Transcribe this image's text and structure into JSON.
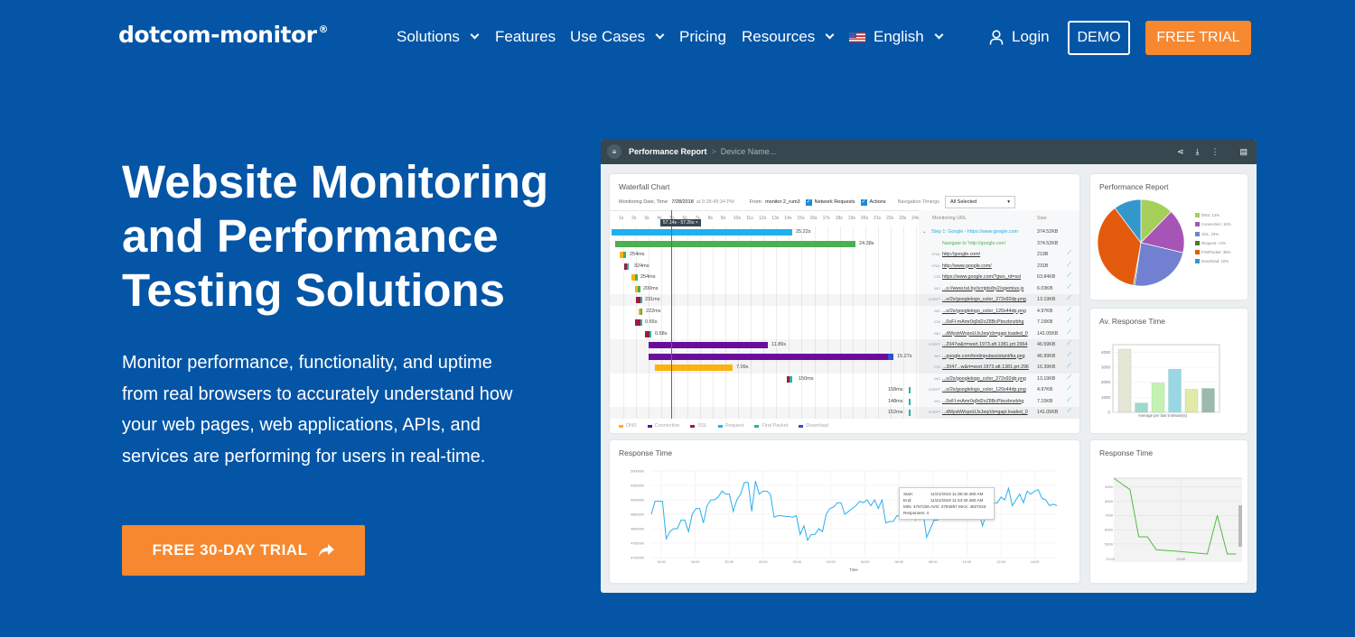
{
  "nav": {
    "logo": "dotcom-monitor",
    "logo_mark": "®",
    "items": [
      "Solutions",
      "Features",
      "Use Cases",
      "Pricing",
      "Resources"
    ],
    "language": "English",
    "login": "Login",
    "demo": "DEMO",
    "free_trial": "FREE TRIAL"
  },
  "hero": {
    "title_lines": [
      "Website Monitoring",
      "and Performance",
      "Testing Solutions"
    ],
    "lead_lines": [
      "Monitor performance, functionality, and uptime",
      "from real browsers to accurately understand how",
      "your web pages, web applications, APIs, and",
      "services are performing for users in real-time."
    ],
    "cta": "FREE 30-DAY TRIAL"
  },
  "dashboard": {
    "header": {
      "title": "Performance Report",
      "breadcrumb_sep": ">",
      "device": "Device Name..."
    },
    "waterfall": {
      "title": "Waterfall Chart",
      "date_label": "Monitoring Date, Time:",
      "date_value": "7/28/2018",
      "time_value": "at 9:28:48:34 PM",
      "from_label": "From:",
      "from_value": "monitor 2_rum3",
      "network_requests": "Network Requests",
      "actions": "Actions",
      "nav_timings": "Navigation Timings",
      "nav_select": "All Selected",
      "ticks": [
        "1s",
        "2s",
        "3s",
        "4s",
        "5s",
        "6s",
        "7s",
        "8s",
        "9s",
        "10s",
        "11s",
        "12s",
        "13s",
        "14s",
        "15s",
        "16s",
        "17s",
        "18s",
        "19s",
        "20s",
        "21s",
        "22s",
        "23s",
        "24s"
      ],
      "cursor_range": "57.14s - 57.26s",
      "col_url": "Monitoring URL",
      "col_size": "Size",
      "rows": [
        {
          "time": "25.22s",
          "type": "",
          "url": "Step 1: Google - https://www.google.com",
          "size": "374.52KB"
        },
        {
          "time": "24.38s",
          "type": "",
          "url": "Navigate to 'http://google.com'",
          "size": "374.52KB"
        },
        {
          "time": "254ms",
          "type": "HTML",
          "url": "http://google.com/",
          "size": "219B"
        },
        {
          "time": "324ms",
          "type": "HTML",
          "url": "http://www.google.com/",
          "size": "231B"
        },
        {
          "time": "254ms",
          "type": "CSS",
          "url": "https://www.google.com/?gws_rd=ssl",
          "size": "63.84KB"
        },
        {
          "time": "200ms",
          "type": "IMG",
          "url": "...s://www.tut.by/scripts/by2/xgemius.js",
          "size": "6.03KB"
        },
        {
          "time": "231ms",
          "type": "SCRIPT",
          "url": "...o/2x/googlelogo_color_272x92dp.png",
          "size": "13.19KB"
        },
        {
          "time": "222ms",
          "type": "IMG",
          "url": "...o/2x/googlelogo_color_120x44dp.png",
          "size": "4.97KB"
        },
        {
          "time": "0.65s",
          "type": "CSS",
          "url": "...0oFI-mAmr0q9d2oZ8BcPbozbnzbhg",
          "size": "7.15KB"
        },
        {
          "time": "0.68s",
          "type": "IMG",
          "url": "...dMysbWxpoUJxJeq/cb=gapi.loaded_0",
          "size": "141.05KB"
        },
        {
          "time": "11.89s",
          "type": "SCRIPT",
          "url": "...2047w&rt=wsrt.1973.aft.1381.prt.2964",
          "size": "46.59KB"
        },
        {
          "time": "15.27s",
          "type": "IMG",
          "url": "...google.com/textinputassistant/tia.png",
          "size": "46.99KB"
        },
        {
          "time": "7.09s",
          "type": "CSS",
          "url": "...2047...w&rt=wsrt.1973.aft.1381.prt.296",
          "size": "16.39KB"
        },
        {
          "time": "150ms",
          "type": "IMG",
          "url": "...o/2x/googlelogo_color_272x92dp.png",
          "size": "13.19KB"
        },
        {
          "time": "158ms",
          "type": "SCRIPT",
          "url": "...o/2x/googlelogo_color_120x44dp.png",
          "size": "4.97KB"
        },
        {
          "time": "148ms",
          "type": "IMG",
          "url": "...0oFI-mAmr0q9d2oZ8BcPbozbnzbhg",
          "size": "7.15KB"
        },
        {
          "time": "152ms",
          "type": "SCRIPT",
          "url": "...dMysbWxpoUJxJeq/cb=gapi.loaded_0",
          "size": "141.05KB"
        }
      ],
      "legend": [
        {
          "name": "DNS",
          "color": "#fbb20f"
        },
        {
          "name": "Connection",
          "color": "#6a0d9a"
        },
        {
          "name": "SSL",
          "color": "#9c1c3c"
        },
        {
          "name": "Request",
          "color": "#1fb0ef"
        },
        {
          "name": "First Packet",
          "color": "#22b5a5"
        },
        {
          "name": "Download",
          "color": "#2e51d6"
        }
      ]
    },
    "perf_pie": {
      "title": "Performance Report",
      "slices": [
        {
          "name": "DNS: 12%",
          "value": 12,
          "color": "#a6cf5a"
        },
        {
          "name": "Connection: 16%",
          "value": 16,
          "color": "#a654b6"
        },
        {
          "name": "SSL: 23%",
          "value": 23,
          "color": "#7180d0"
        },
        {
          "name": "Request: <1%",
          "value": 0.5,
          "color": "#4d7a2a"
        },
        {
          "name": "FirstPacket: 36%",
          "value": 36,
          "color": "#e45a0c"
        },
        {
          "name": "Download: 10%",
          "value": 10,
          "color": "#3497cc"
        }
      ]
    },
    "avg_bar": {
      "title": "Av. Response Time",
      "yticks": [
        "0",
        "1000",
        "2000",
        "3000",
        "4000"
      ],
      "xlabel": "Average per last 5 Minute(s)",
      "values": [
        4200,
        620,
        1950,
        2870,
        1530,
        1590
      ],
      "colors": [
        "#e5e6d5",
        "#9fd9cc",
        "#c4f2b0",
        "#9ad7e5",
        "#e2eaa5",
        "#9cb9ac"
      ]
    },
    "response_line": {
      "title": "Response Time",
      "xlabel": "Time",
      "yticks": [
        "4700000",
        "4750000",
        "4800000",
        "4850000",
        "4900000",
        "4950000",
        "5000000"
      ],
      "xticks": [
        "16:00",
        "18:00",
        "20:00",
        "22:00",
        "00:00",
        "02:00",
        "04:00",
        "06:00",
        "08:00",
        "10:00",
        "12:00",
        "14:00"
      ],
      "values": [
        4850000,
        4895000,
        4895000,
        4895000,
        4765000,
        4790000,
        4800000,
        4800000,
        4830000,
        4830000,
        4790000,
        4850000,
        4870000,
        4870000,
        4820000,
        4880000,
        4900000,
        4900000,
        4910000,
        4930000,
        4920000,
        4920000,
        4860000,
        4900000,
        4920000,
        4960000,
        4960000,
        4860000,
        4965000,
        4920000,
        4930000,
        4930000,
        4920000,
        4840000,
        4845000,
        4845000,
        4843000,
        4842000,
        4840000,
        4845000,
        4780000,
        4810000,
        4760000,
        4780000,
        4780000,
        4800000,
        4790000,
        4850000,
        4870000,
        4875000,
        4890000,
        4890000,
        4850000,
        4860000,
        4870000,
        4880000,
        4895000,
        4890000,
        4900000,
        4880000,
        4900000,
        4870000,
        4900000,
        4820000,
        4825000,
        4825000,
        4845000,
        4845000,
        4844000,
        4844000,
        4850000,
        4830000,
        4870000,
        4860000,
        4770000,
        4800000,
        4830000,
        4830000,
        4850000,
        4900000,
        4880000,
        4860000,
        4860000,
        4850000,
        4860000,
        4850000,
        4850000,
        4855000,
        4860000,
        4810000,
        4850000,
        4870000,
        4890000,
        4890000,
        4910000,
        4900000,
        4940000,
        4880000,
        4900000,
        4920000,
        4890000,
        4930000,
        4920000,
        4930000,
        4935000,
        4905000,
        4900000,
        4880000,
        4885000,
        4880000
      ],
      "tooltip": {
        "start_label": "Start:",
        "start": "11/21/2019 11:39:40.480 AM",
        "end_label": "End:",
        "end": "11/21/2019 11:43:40.480 AM",
        "stats": "MIN: 4757226 AVG: 4794957 MAX: 4827223",
        "responses_label": "Responses:",
        "responses": "4"
      }
    },
    "response_small": {
      "title": "Response Time",
      "yticks": [
        "5000",
        "6000",
        "7000",
        "8000",
        "9000"
      ],
      "xticks": [
        "13:40",
        "13:50"
      ],
      "values": [
        9600,
        8800,
        5500,
        5500,
        4600,
        4500,
        4400,
        4300,
        7000,
        4300,
        4300
      ],
      "color": "#4cbe3b"
    }
  }
}
